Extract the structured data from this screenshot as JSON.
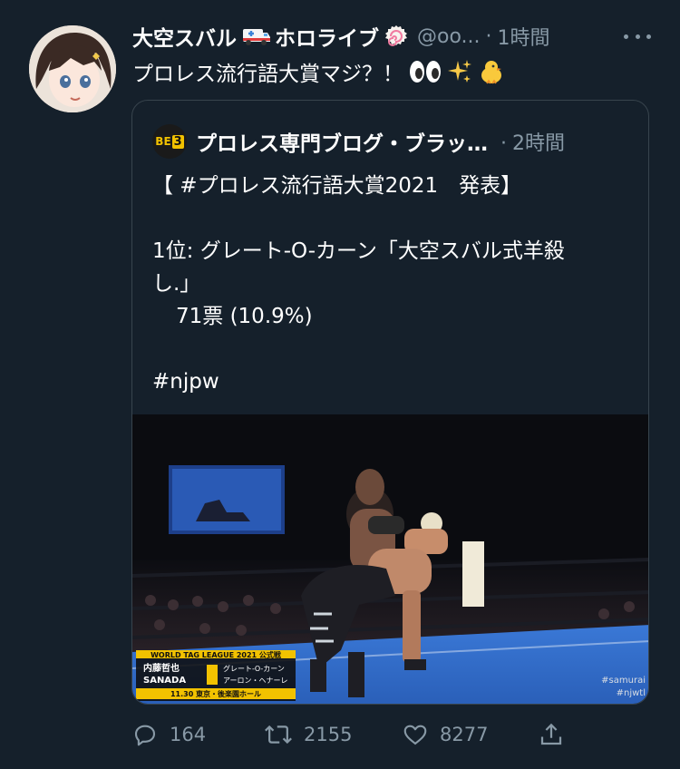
{
  "tweet": {
    "display_name": "大空スバル",
    "display_name_2": "ホロライブ",
    "handle": "@oo...",
    "time": "1時間",
    "text": "プロレス流行語大賞マジ？！"
  },
  "quote": {
    "account_name": "プロレス専門ブログ・ブラッ…",
    "time": "2時間",
    "lines": {
      "l1": "【 #プロレス流行語大賞2021　発表】",
      "l2": "1位: グレート-O-カーン「大空スバル式羊殺",
      "l3": "し.」",
      "l4": "71票 (10.9%)",
      "l5": "#njpw"
    },
    "image_overlay": {
      "event": "WORLD TAG LEAGUE 2021 公式戦",
      "team1_a": "内藤哲也",
      "team1_b": "SANADA",
      "team2_a": "グレート-O-カーン",
      "team2_b": "アーロン・ヘナーレ",
      "venue": "11.30 東京・後楽園ホール",
      "tag1": "#samurai",
      "tag2": "#njwtl"
    }
  },
  "actions": {
    "replies": "164",
    "retweets": "2155",
    "likes": "8277"
  },
  "colors": {
    "background": "#15202b",
    "secondary_text": "#8899a6",
    "border": "#38444d"
  },
  "icons": [
    "ambulance-emoji",
    "naruto-emoji",
    "eyes-emoji",
    "sparkles-emoji",
    "chick-emoji",
    "reply-icon",
    "retweet-icon",
    "like-icon",
    "share-icon",
    "more-icon"
  ]
}
